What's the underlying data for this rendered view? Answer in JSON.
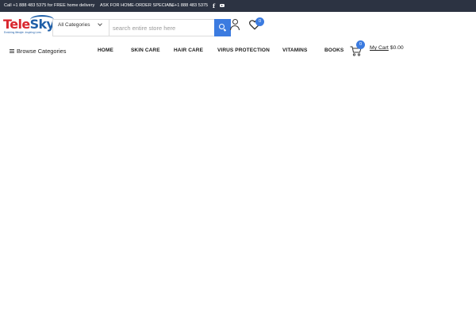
{
  "topbar": {
    "delivery_text": "Call +1 888 483 5375 for FREE home delivery",
    "specials_text": "ASK FOR HOME-ORDER SPECIALS",
    "phone": "+1 888 483 5375",
    "social_facebook_glyph": "f"
  },
  "logo": {
    "tele": "Tele",
    "sky": "Sky",
    "tagline": "Enriching lifestyle. Inspiring Lives"
  },
  "search": {
    "category_selected": "All Categories",
    "placeholder": "search entire store here"
  },
  "wishlist": {
    "count": "0"
  },
  "cart": {
    "count": "0",
    "label": "My Cart",
    "amount": "$0.00"
  },
  "nav": {
    "browse_label": "Browse Categories",
    "items": [
      "HOME",
      "SKIN CARE",
      "HAIR CARE",
      "VIRUS PROTECTION",
      "VITAMINS",
      "BOOKS"
    ]
  },
  "colors": {
    "topbar_bg": "#2c3342",
    "accent": "#3b7be0",
    "logo_red": "#d9262e",
    "logo_blue": "#1f5fa8"
  }
}
